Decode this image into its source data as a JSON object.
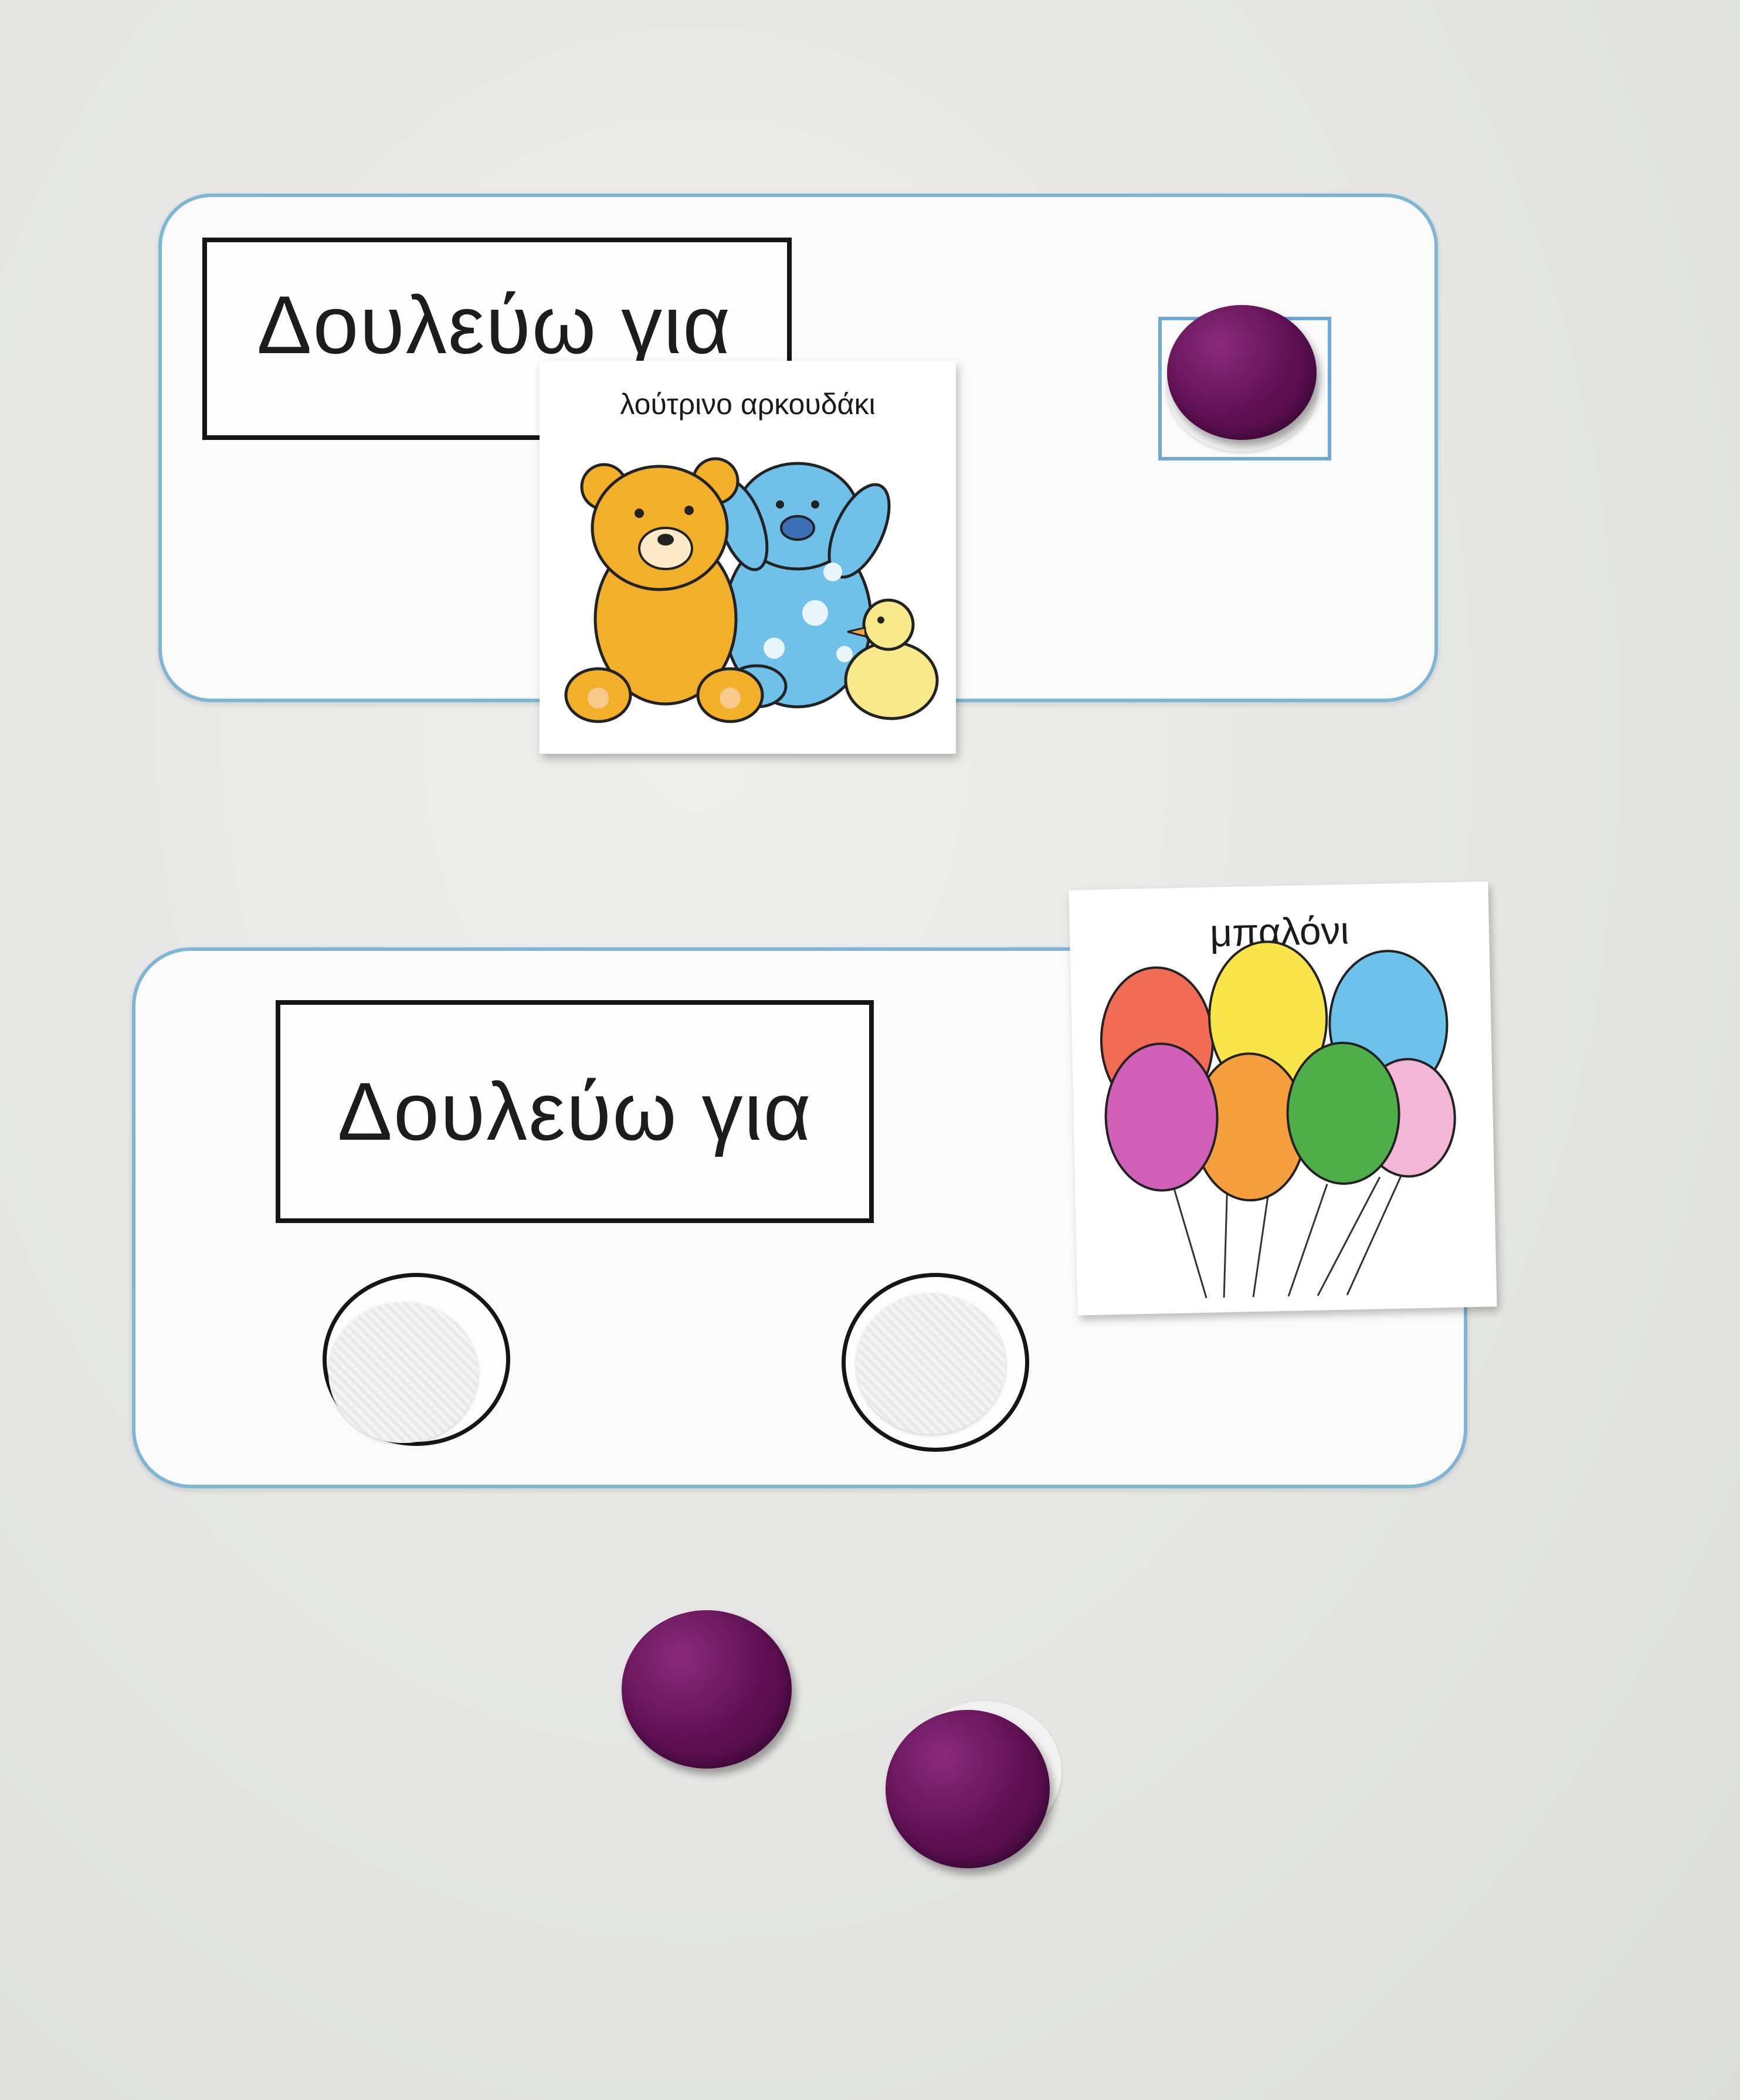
{
  "board_top": {
    "label": "Δουλεύω για",
    "reward_card": {
      "title": "λούτρινο αρκουδάκι",
      "image": "teddy-bear-plush-toys-illustration"
    }
  },
  "board_bottom": {
    "label": "Δουλεύω για",
    "reward_card": {
      "title": "μπαλόνι",
      "image": "balloons-illustration"
    }
  },
  "colors": {
    "card_border": "#7fb6d6",
    "token": "#5e0f52",
    "background": "#e7e8e6"
  }
}
